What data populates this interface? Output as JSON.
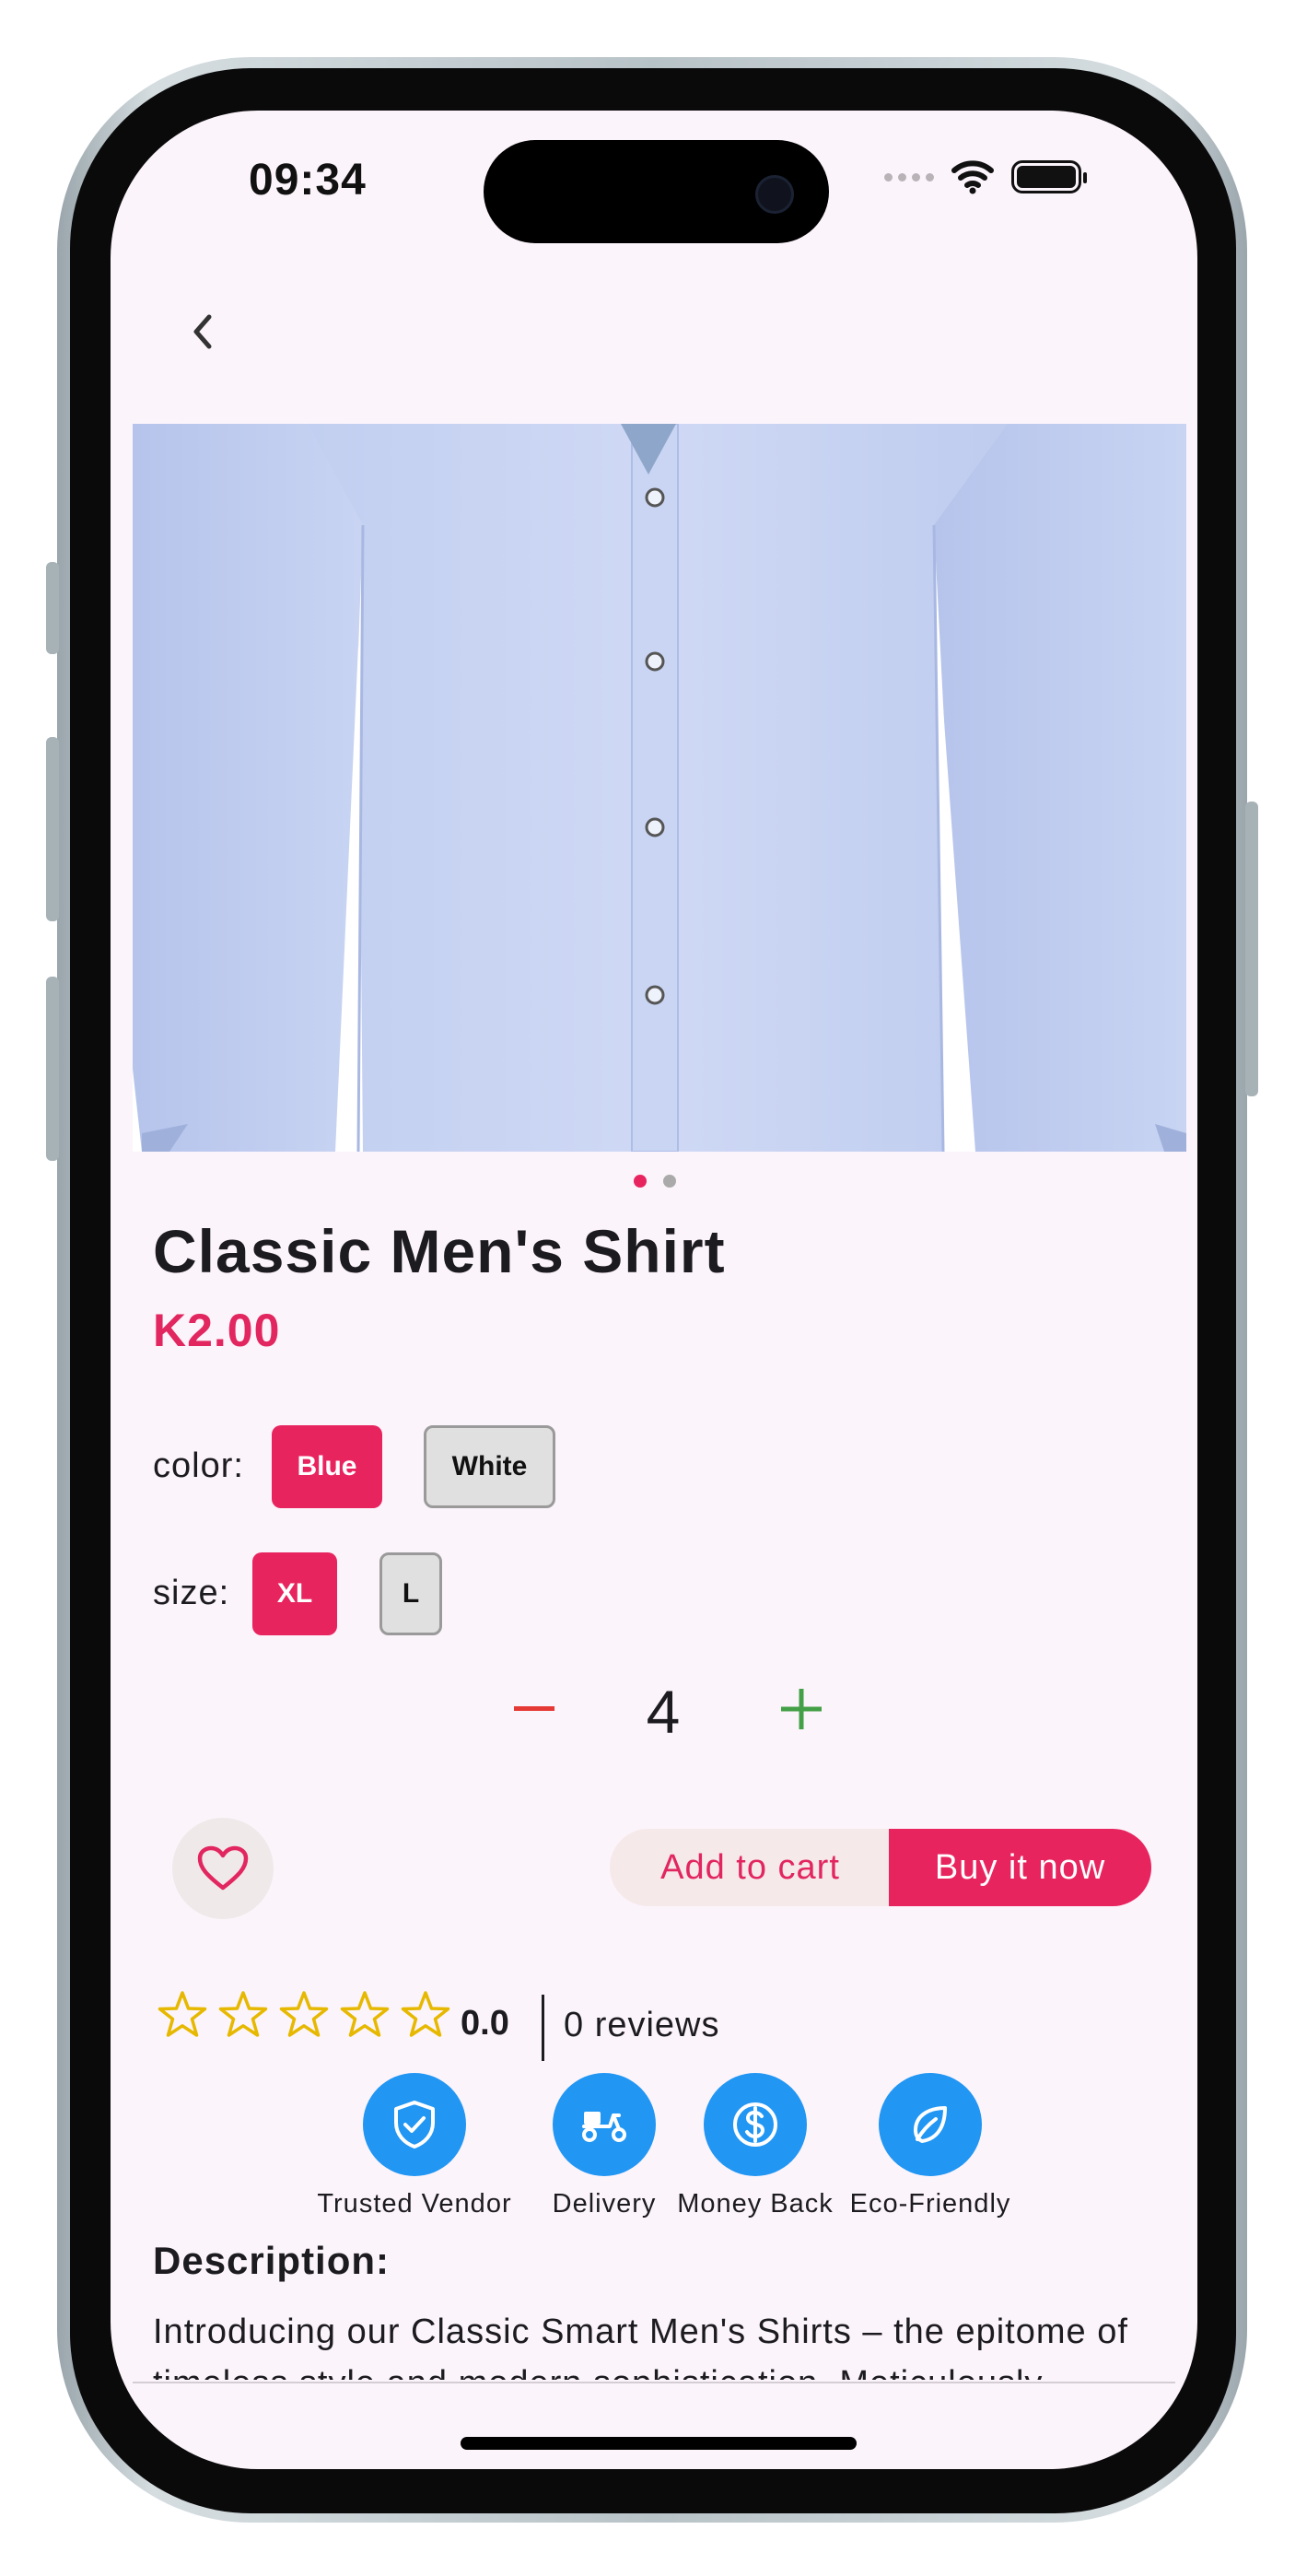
{
  "status_bar": {
    "time": "09:34"
  },
  "product": {
    "title": "Classic Men's Shirt",
    "price": "K2.00",
    "image_count": 2,
    "active_image": 1
  },
  "options": {
    "color_label": "color:",
    "colors": [
      {
        "label": "Blue",
        "selected": true
      },
      {
        "label": "White",
        "selected": false
      }
    ],
    "size_label": "size:",
    "sizes": [
      {
        "label": "XL",
        "selected": true
      },
      {
        "label": "L",
        "selected": false
      }
    ]
  },
  "quantity": {
    "value": "4"
  },
  "actions": {
    "add_to_cart": "Add to cart",
    "buy_now": "Buy it now"
  },
  "rating": {
    "stars_filled": 0,
    "stars_total": 5,
    "value": "0.0",
    "reviews": "0 reviews"
  },
  "features": [
    {
      "label": "Trusted Vendor",
      "icon": "shield-check-icon"
    },
    {
      "label": "Delivery",
      "icon": "scooter-icon"
    },
    {
      "label": "Money Back",
      "icon": "dollar-icon"
    },
    {
      "label": "Eco-Friendly",
      "icon": "leaf-icon"
    }
  ],
  "description": {
    "title": "Description:",
    "body": "Introducing our Classic Smart Men's Shirts – the epitome of timeless style and modern sophistication. Meticulously"
  },
  "colors": {
    "accent": "#e8245f",
    "price": "#e2265f",
    "feature_blue": "#2196f3",
    "minus_red": "#e53935",
    "plus_green": "#43a047",
    "background": "#fcf4fb"
  }
}
